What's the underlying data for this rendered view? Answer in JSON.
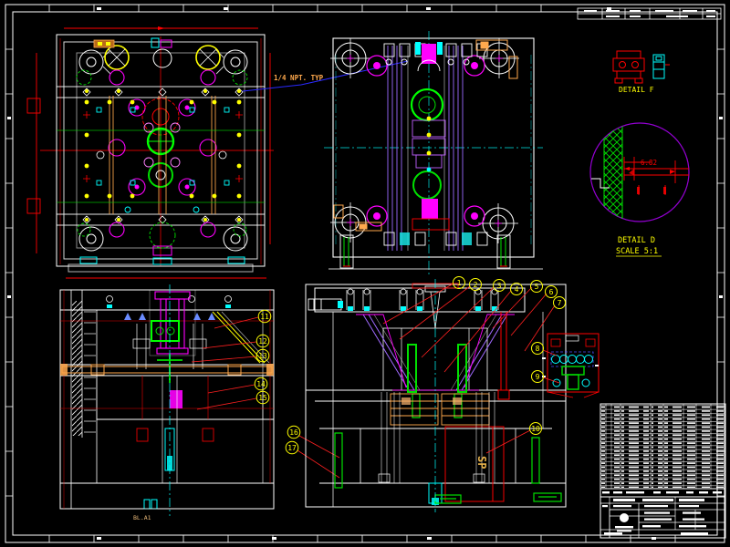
{
  "drawing": {
    "type": "CAD mold assembly drawing",
    "annotations": {
      "npt_note": "1/4 NPT. TYP",
      "detail_f_label": "DETAIL F",
      "detail_d_label": "DETAIL D",
      "detail_d_scale": "SCALE 5:1",
      "detail_d_dim": "6.82",
      "sp_marking": "SP",
      "base_label": "BL.A1"
    },
    "balloons": {
      "section_middle": [
        "1",
        "2",
        "3",
        "4",
        "5",
        "6",
        "7",
        "8",
        "9",
        "10"
      ],
      "section_left": [
        "11",
        "12",
        "13",
        "14",
        "15",
        "16",
        "17"
      ]
    },
    "parts_list": {
      "visible_rows": 21,
      "legible": false
    },
    "colors": {
      "background": "#000000",
      "frame_white": "#ffffff",
      "dimension_red": "#ff0000",
      "magenta": "#ff00ff",
      "cyan": "#00ffff",
      "green": "#00e000",
      "yellow": "#ffff00",
      "orange": "#ffa94d",
      "purple_rail": "#9b6bff",
      "detail_circle_violet": "#9400d3",
      "leader_blue": "#2a2aff",
      "tan_text": "#e8b34b"
    }
  }
}
